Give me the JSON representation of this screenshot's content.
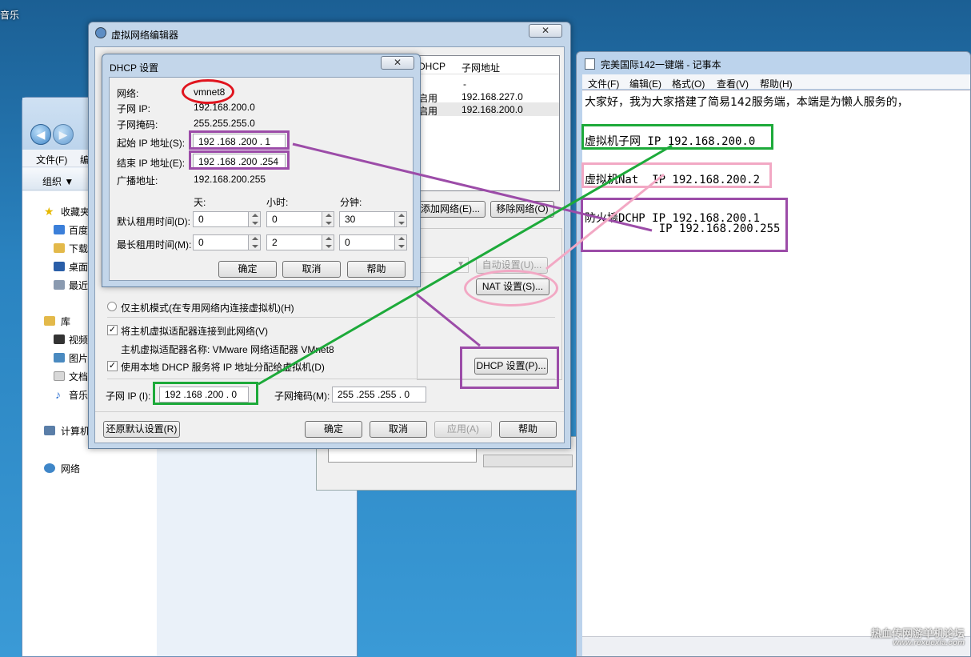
{
  "desktop": {
    "label": "音乐"
  },
  "explorer": {
    "menu": [
      "文件(F)",
      "编"
    ],
    "toolbar": {
      "organize": "组织 ▼"
    },
    "sidebar": [
      "收藏夹",
      "百度",
      "下载",
      "桌面",
      "最近",
      "库",
      "视频",
      "图片",
      "文档",
      "音乐",
      "计算机",
      "网络"
    ]
  },
  "vnet_editor": {
    "title": "虚拟网络编辑器",
    "close": "✕",
    "table_headers": {
      "dhcp": "DHCP",
      "subnet": "子网地址"
    },
    "rows": [
      {
        "dhcp": "-",
        "subnet": ""
      },
      {
        "dhcp": "启用",
        "subnet": "192.168.227.0"
      },
      {
        "dhcp": "启用",
        "subnet": "192.168.200.0"
      }
    ],
    "add_network": "添加网络(E)...",
    "remove_network": "移除网络(O)",
    "auto_settings": "自动设置(U)...",
    "nat_settings": "NAT 设置(S)...",
    "host_only": "仅主机模式(在专用网络内连接虚拟机)(H)",
    "connect_adapter": "将主机虚拟适配器连接到此网络(V)",
    "adapter_name": "主机虚拟适配器名称: VMware 网络适配器 VMnet8",
    "use_dhcp": "使用本地 DHCP 服务将 IP 地址分配给虚拟机(D)",
    "dhcp_settings": "DHCP 设置(P)...",
    "subnet_ip_label": "子网 IP (I):",
    "subnet_ip": "192 .168 .200 .  0",
    "mask_label": "子网掩码(M):",
    "mask": "255 .255 .255 .  0",
    "restore": "还原默认设置(R)",
    "ok": "确定",
    "cancel": "取消",
    "apply": "应用(A)",
    "help": "帮助"
  },
  "dhcp_dialog": {
    "title": "DHCP 设置",
    "close": "✕",
    "network_label": "网络:",
    "network": "vmnet8",
    "subnet_ip_label": "子网 IP:",
    "subnet_ip": "192.168.200.0",
    "mask_label": "子网掩码:",
    "mask": "255.255.255.0",
    "start_label": "起始 IP 地址(S):",
    "start_ip": "192 .168 .200 .  1",
    "end_label": "结束 IP 地址(E):",
    "end_ip": "192 .168 .200 .254",
    "broadcast_label": "广播地址:",
    "broadcast": "192.168.200.255",
    "days": "天:",
    "hours": "小时:",
    "minutes": "分钟:",
    "default_lease": "默认租用时间(D):",
    "default_values": [
      "0",
      "0",
      "30"
    ],
    "max_lease": "最长租用时间(M):",
    "max_values": [
      "0",
      "2",
      "0"
    ],
    "ok": "确定",
    "cancel": "取消",
    "help": "帮助"
  },
  "notepad": {
    "title": "完美国际142一键端 - 记事本",
    "menu": [
      "文件(F)",
      "编辑(E)",
      "格式(O)",
      "查看(V)",
      "帮助(H)"
    ],
    "intro": "大家好，我为大家搭建了简易142服务端，本端是为懒人服务的，",
    "line_subnet": "虚拟机子网 IP 192.168.200.0",
    "line_nat": "虚拟机Nat  IP 192.168.200.2",
    "line_dhcp": "防火墙DCHP IP 192.168.200.1",
    "line_broadcast": "           IP 192.168.200.255"
  },
  "watermark": {
    "title": "热血传网游单机论坛",
    "url": "www.rexuexia.com"
  },
  "colors": {
    "green": "#1daa3a",
    "purple": "#9c4ca8",
    "pink": "#f2a8c4",
    "red": "#e0141e"
  }
}
